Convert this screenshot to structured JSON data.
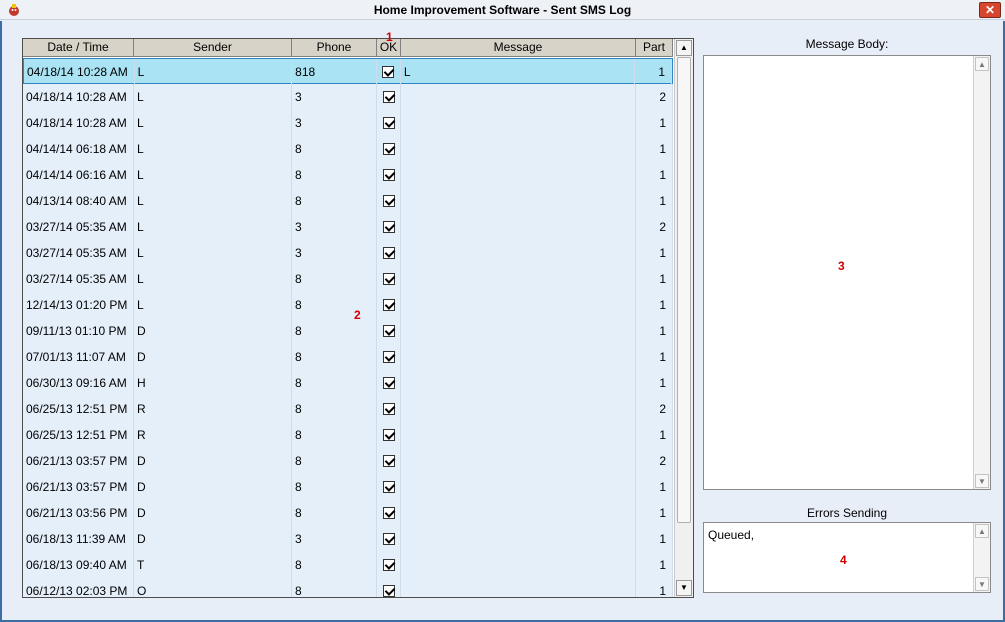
{
  "window": {
    "title": "Home Improvement Software - Sent SMS Log",
    "close_label": "✕"
  },
  "grid": {
    "columns": [
      "Date / Time",
      "Sender",
      "Phone",
      "OK",
      "Message",
      "Part"
    ],
    "rows": [
      {
        "date": "04/18/14 10:28 AM",
        "sender": "L",
        "phone": "818",
        "ok": true,
        "message": "L",
        "part": "1",
        "selected": true
      },
      {
        "date": "04/18/14 10:28 AM",
        "sender": "L",
        "phone": "3",
        "ok": true,
        "message": "",
        "part": "2"
      },
      {
        "date": "04/18/14 10:28 AM",
        "sender": "L",
        "phone": "3",
        "ok": true,
        "message": "",
        "part": "1"
      },
      {
        "date": "04/14/14 06:18 AM",
        "sender": "L",
        "phone": "8",
        "ok": true,
        "message": "",
        "part": "1"
      },
      {
        "date": "04/14/14 06:16 AM",
        "sender": "L",
        "phone": "8",
        "ok": true,
        "message": "",
        "part": "1"
      },
      {
        "date": "04/13/14 08:40 AM",
        "sender": "L",
        "phone": "8",
        "ok": true,
        "message": "",
        "part": "1"
      },
      {
        "date": "03/27/14 05:35 AM",
        "sender": "L",
        "phone": "3",
        "ok": true,
        "message": "",
        "part": "2"
      },
      {
        "date": "03/27/14 05:35 AM",
        "sender": "L",
        "phone": "3",
        "ok": true,
        "message": "",
        "part": "1"
      },
      {
        "date": "03/27/14 05:35 AM",
        "sender": "L",
        "phone": "8",
        "ok": true,
        "message": "",
        "part": "1"
      },
      {
        "date": "12/14/13 01:20 PM",
        "sender": "L",
        "phone": "8",
        "ok": true,
        "message": "",
        "part": "1"
      },
      {
        "date": "09/11/13 01:10 PM",
        "sender": "D",
        "phone": "8",
        "ok": true,
        "message": "",
        "part": "1"
      },
      {
        "date": "07/01/13 11:07 AM",
        "sender": "D",
        "phone": "8",
        "ok": true,
        "message": "",
        "part": "1"
      },
      {
        "date": "06/30/13 09:16 AM",
        "sender": "H",
        "phone": "8",
        "ok": true,
        "message": "",
        "part": "1"
      },
      {
        "date": "06/25/13 12:51 PM",
        "sender": "R",
        "phone": "8",
        "ok": true,
        "message": "",
        "part": "2"
      },
      {
        "date": "06/25/13 12:51 PM",
        "sender": "R",
        "phone": "8",
        "ok": true,
        "message": "",
        "part": "1"
      },
      {
        "date": "06/21/13 03:57 PM",
        "sender": "D",
        "phone": "8",
        "ok": true,
        "message": "",
        "part": "2"
      },
      {
        "date": "06/21/13 03:57 PM",
        "sender": "D",
        "phone": "8",
        "ok": true,
        "message": "",
        "part": "1"
      },
      {
        "date": "06/21/13 03:56 PM",
        "sender": "D",
        "phone": "8",
        "ok": true,
        "message": "",
        "part": "1"
      },
      {
        "date": "06/18/13 11:39 AM",
        "sender": "D",
        "phone": "3",
        "ok": true,
        "message": "",
        "part": "1"
      },
      {
        "date": "06/18/13 09:40 AM",
        "sender": "T",
        "phone": "8",
        "ok": true,
        "message": "",
        "part": "1"
      },
      {
        "date": "06/12/13 02:03 PM",
        "sender": "O",
        "phone": "8",
        "ok": true,
        "message": "",
        "part": "1"
      }
    ]
  },
  "message_body": {
    "label": "Message Body:",
    "text": ""
  },
  "errors": {
    "label": "Errors Sending",
    "text": "Queued,"
  },
  "markers": [
    "1",
    "2",
    "3",
    "4"
  ],
  "scroll_icons": {
    "up": "▲",
    "down": "▼"
  },
  "colors": {
    "selected_row": "#a9e3f4",
    "row_bg": "#e4effa",
    "marker": "#d40000"
  }
}
